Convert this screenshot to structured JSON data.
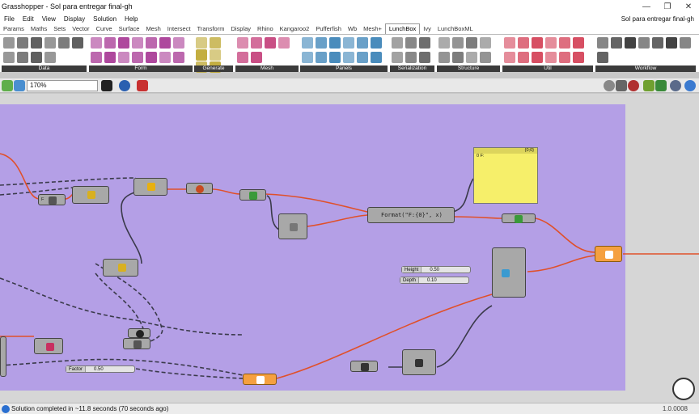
{
  "window": {
    "title": "Grasshopper - Sol para entregar final-gh",
    "min_icon": "minimize-icon",
    "max_icon": "maximize-icon",
    "close_icon": "close-icon",
    "min_glyph": "—",
    "max_glyph": "❐",
    "close_glyph": "✕"
  },
  "menu": {
    "items": [
      "File",
      "Edit",
      "View",
      "Display",
      "Solution",
      "Help"
    ],
    "document_name": "Sol para entregar final-gh"
  },
  "tabs": [
    "Params",
    "Maths",
    "Sets",
    "Vector",
    "Curve",
    "Surface",
    "Mesh",
    "Intersect",
    "Transform",
    "Display",
    "Rhino",
    "Kangaroo2",
    "Pufferfish",
    "Wb",
    "Mesh+",
    "LunchBox",
    "Ivy",
    "LunchBoxML"
  ],
  "active_tab": "LunchBox",
  "ribbon": {
    "groups": [
      {
        "label": "Data",
        "icon_count": 10,
        "color": "#444444"
      },
      {
        "label": "Form",
        "icon_count": 14,
        "color": "#a0288c"
      },
      {
        "label": "Generate",
        "icon_count": 6,
        "color": "#b8a020"
      },
      {
        "label": "Mesh",
        "icon_count": 6,
        "color": "#c03070"
      },
      {
        "label": "Panels",
        "icon_count": 12,
        "color": "#2a78b0"
      },
      {
        "label": "Serialization",
        "icon_count": 6,
        "color": "#555555"
      },
      {
        "label": "Structure",
        "icon_count": 8,
        "color": "#666666"
      },
      {
        "label": "Util",
        "icon_count": 12,
        "color": "#d03048"
      },
      {
        "label": "Workflow",
        "icon_count": 8,
        "color": "#222222"
      }
    ]
  },
  "toolbar": {
    "zoom_value": "170%"
  },
  "canvas": {
    "panel_header": "{0;0}",
    "panel_line": "0  F:",
    "format_expression": "Format(\"F:{0}\", x)",
    "sliders": [
      {
        "name": "Height",
        "value": "0.50"
      },
      {
        "name": "Depth",
        "value": "0.10"
      },
      {
        "name": "Factor",
        "value": "0.50"
      }
    ]
  },
  "status": {
    "text": "Solution completed in ~11.8 seconds (70 seconds ago)",
    "version": "1.0.0008"
  },
  "colors": {
    "group": "#b49fe6",
    "wire_selected": "#e0502a",
    "wire_default": "#3a3a4a",
    "panel": "#f6ef6a",
    "component": "#a8a8a8"
  }
}
